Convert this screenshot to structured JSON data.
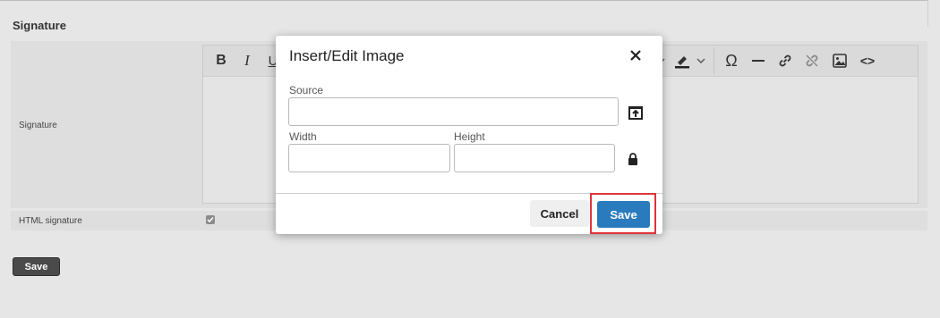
{
  "section_title": "Signature",
  "form": {
    "signature_label": "Signature",
    "html_signature_label": "HTML signature",
    "html_signature_checked": true,
    "save_label": "Save"
  },
  "editor": {
    "toolbar": [
      {
        "name": "bold",
        "glyph": "B"
      },
      {
        "name": "italic",
        "glyph": "I"
      },
      {
        "name": "underline",
        "glyph": "U"
      },
      {
        "name": "text-color"
      },
      {
        "name": "background-color"
      },
      {
        "name": "special-character",
        "glyph": "Ω"
      },
      {
        "name": "horizontal-line"
      },
      {
        "name": "link"
      },
      {
        "name": "unlink"
      },
      {
        "name": "image"
      },
      {
        "name": "source-code",
        "glyph": "<>"
      }
    ]
  },
  "dialog": {
    "title": "Insert/Edit Image",
    "source_label": "Source",
    "source_value": "",
    "width_label": "Width",
    "width_value": "",
    "height_label": "Height",
    "height_value": "",
    "cancel_label": "Cancel",
    "save_label": "Save"
  },
  "colors": {
    "primary_button": "#2a7bbd",
    "highlight_border": "#e0323a",
    "page_background": "#e6e6e6"
  }
}
